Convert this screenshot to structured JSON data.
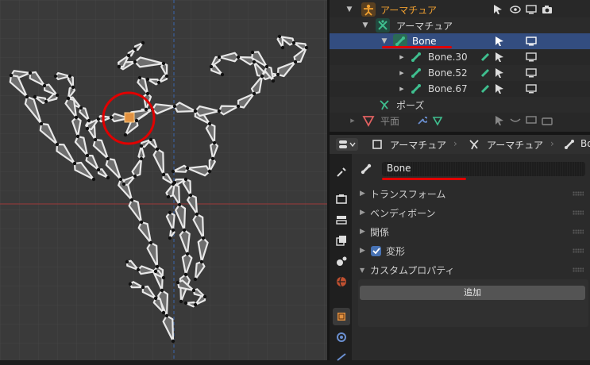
{
  "outliner": {
    "items": [
      {
        "label": "アーマチュア",
        "kind": "object",
        "icon": "armature-object-icon",
        "color": "#f0a030"
      },
      {
        "label": "アーマチュア",
        "kind": "data",
        "icon": "armature-data-icon"
      },
      {
        "label": "Bone",
        "kind": "bone",
        "icon": "bone-icon",
        "selected": true
      },
      {
        "label": "Bone.30",
        "kind": "bone",
        "icon": "bone-icon"
      },
      {
        "label": "Bone.52",
        "kind": "bone",
        "icon": "bone-icon"
      },
      {
        "label": "Bone.67",
        "kind": "bone",
        "icon": "bone-icon"
      },
      {
        "label": "ポーズ",
        "kind": "pose",
        "icon": "pose-icon"
      },
      {
        "label": "平面",
        "kind": "mesh",
        "icon": "mesh-object-icon"
      }
    ]
  },
  "properties": {
    "breadcrumb": [
      "アーマチュア",
      "アーマチュア",
      "Bo"
    ],
    "bone_name": "Bone",
    "panels": [
      {
        "label": "トランスフォーム",
        "expanded": false
      },
      {
        "label": "ベンディボーン",
        "expanded": false
      },
      {
        "label": "関係",
        "expanded": false
      },
      {
        "label": "変形",
        "expanded": false,
        "checked": true
      },
      {
        "label": "カスタムプロパティ",
        "expanded": true
      }
    ],
    "add_button": "追加"
  },
  "colors": {
    "selection": "#334d80",
    "annotation_red": "#e00000",
    "bone_green": "#3fbf8f",
    "armature_orange": "#f0a030"
  }
}
